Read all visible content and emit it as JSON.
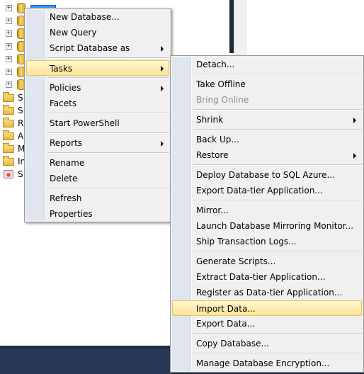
{
  "tree": {
    "selected_item_label": "",
    "rows": [
      {
        "label": ""
      },
      {
        "label": "S"
      },
      {
        "label": "S"
      },
      {
        "label": "R"
      },
      {
        "label": "A"
      },
      {
        "label": "M"
      },
      {
        "label": "In"
      },
      {
        "label": "S"
      }
    ]
  },
  "context_menu": {
    "items": [
      {
        "label": "New Database..."
      },
      {
        "label": "New Query"
      },
      {
        "label": "Script Database as"
      },
      {
        "label": "Tasks"
      },
      {
        "label": "Policies"
      },
      {
        "label": "Facets"
      },
      {
        "label": "Start PowerShell"
      },
      {
        "label": "Reports"
      },
      {
        "label": "Rename"
      },
      {
        "label": "Delete"
      },
      {
        "label": "Refresh"
      },
      {
        "label": "Properties"
      }
    ]
  },
  "tasks_submenu": {
    "items": [
      {
        "label": "Detach..."
      },
      {
        "label": "Take Offline"
      },
      {
        "label": "Bring Online"
      },
      {
        "label": "Shrink"
      },
      {
        "label": "Back Up..."
      },
      {
        "label": "Restore"
      },
      {
        "label": "Deploy Database to SQL Azure..."
      },
      {
        "label": "Export Data-tier Application..."
      },
      {
        "label": "Mirror..."
      },
      {
        "label": "Launch Database Mirroring Monitor..."
      },
      {
        "label": "Ship Transaction Logs..."
      },
      {
        "label": "Generate Scripts..."
      },
      {
        "label": "Extract Data-tier Application..."
      },
      {
        "label": "Register as Data-tier Application..."
      },
      {
        "label": "Import Data..."
      },
      {
        "label": "Export Data..."
      },
      {
        "label": "Copy Database..."
      },
      {
        "label": "Manage Database Encryption..."
      }
    ]
  },
  "colors": {
    "menu_background": "#f0f0f0",
    "highlight_border": "#e5c365",
    "highlight_fill": "#fbe59a",
    "selection_blue": "#3399ff",
    "taskbar": "#293955"
  }
}
